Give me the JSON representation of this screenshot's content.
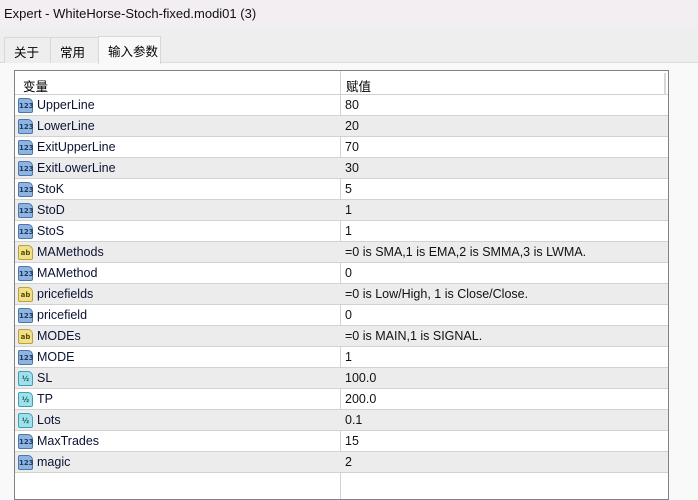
{
  "window": {
    "title": "Expert - WhiteHorse-Stoch-fixed.modi01 (3)"
  },
  "tabs": [
    {
      "label": "关于"
    },
    {
      "label": "常用"
    },
    {
      "label": "输入参数",
      "active": true
    }
  ],
  "table": {
    "headers": {
      "variable": "变量",
      "value": "赋值"
    },
    "rows": [
      {
        "type": "int",
        "icon": "123",
        "name": "UpperLine",
        "value": "80"
      },
      {
        "type": "int",
        "icon": "123",
        "name": "LowerLine",
        "value": "20"
      },
      {
        "type": "int",
        "icon": "123",
        "name": "ExitUpperLine",
        "value": "70"
      },
      {
        "type": "int",
        "icon": "123",
        "name": "ExitLowerLine",
        "value": "30"
      },
      {
        "type": "int",
        "icon": "123",
        "name": "StoK",
        "value": "5"
      },
      {
        "type": "int",
        "icon": "123",
        "name": "StoD",
        "value": "1"
      },
      {
        "type": "int",
        "icon": "123",
        "name": "StoS",
        "value": "1"
      },
      {
        "type": "str",
        "icon": "ab",
        "name": "MAMethods",
        "value": " =0 is SMA,1 is EMA,2 is SMMA,3 is LWMA."
      },
      {
        "type": "int",
        "icon": "123",
        "name": "MAMethod",
        "value": "0"
      },
      {
        "type": "str",
        "icon": "ab",
        "name": "pricefields",
        "value": " =0 is Low/High, 1 is Close/Close."
      },
      {
        "type": "int",
        "icon": "123",
        "name": "pricefield",
        "value": "0"
      },
      {
        "type": "str",
        "icon": "ab",
        "name": "MODEs",
        "value": " =0 is MAIN,1 is SIGNAL."
      },
      {
        "type": "int",
        "icon": "123",
        "name": "MODE",
        "value": "1"
      },
      {
        "type": "dbl",
        "icon": "½",
        "name": "SL",
        "value": "100.0"
      },
      {
        "type": "dbl",
        "icon": "½",
        "name": "TP",
        "value": "200.0"
      },
      {
        "type": "dbl",
        "icon": "½",
        "name": "Lots",
        "value": "0.1"
      },
      {
        "type": "int",
        "icon": "123",
        "name": "MaxTrades",
        "value": "15"
      },
      {
        "type": "int",
        "icon": "123",
        "name": "magic",
        "value": "2"
      }
    ]
  }
}
